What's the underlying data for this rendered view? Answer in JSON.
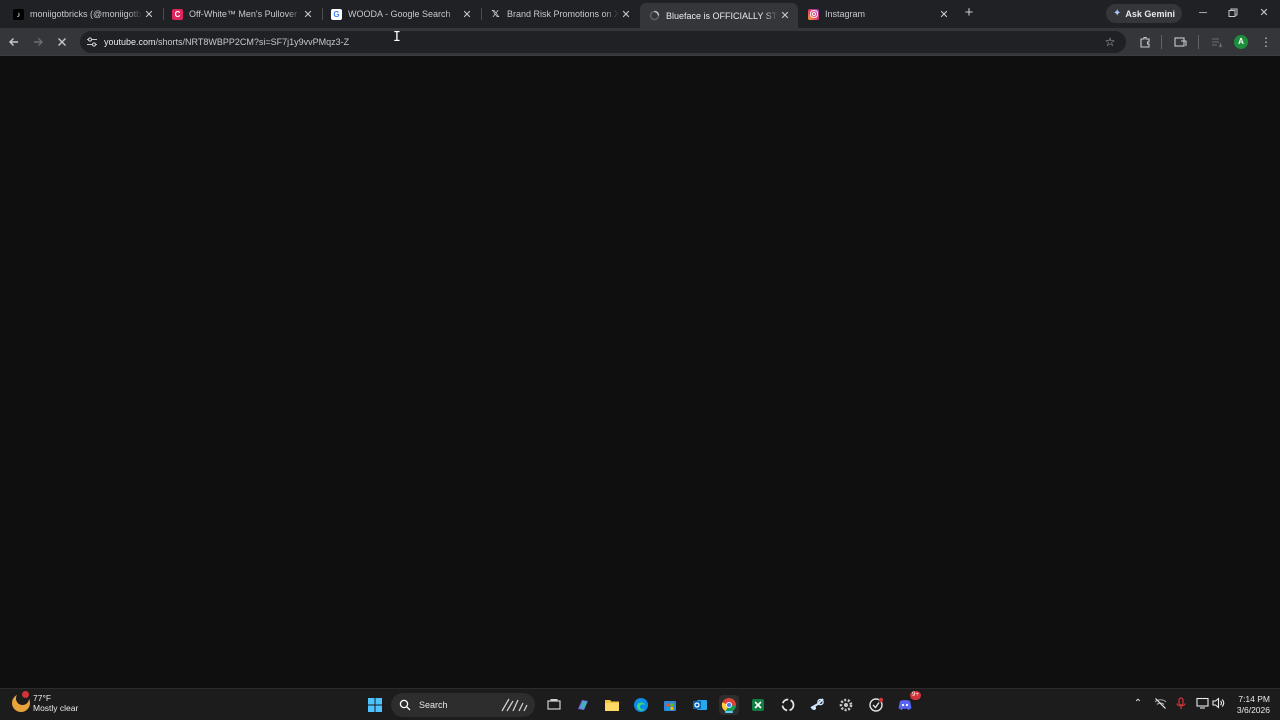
{
  "tabs": [
    {
      "title": "moniigotbricks (@moniigotbricks)",
      "favicon": "tiktok-icon"
    },
    {
      "title": "Off-White™ Men's Pullover Hoodie",
      "favicon": "off-white-icon"
    },
    {
      "title": "WOODA - Google Search",
      "favicon": "google-icon"
    },
    {
      "title": "Brand Risk Promotions on X: \"Blueface",
      "favicon": "x-icon"
    },
    {
      "title": "Blueface is OFFICIALLY STRONG",
      "favicon": "loading-icon"
    },
    {
      "title": "Instagram",
      "favicon": "instagram-icon"
    }
  ],
  "gemini": {
    "label": "Ask Gemini"
  },
  "omnibox": {
    "host": "youtube.com",
    "path": "/shorts/NRT8WBPP2CM?si=SF7j1y9vvPMqz3-Z"
  },
  "profile": {
    "initial": "A",
    "color": "#1e8e3e"
  },
  "taskbar": {
    "weather": {
      "temp": "77°F",
      "condition": "Mostly clear"
    },
    "search_label": "Search",
    "discord_badge": "9+",
    "clock": {
      "time": "7:14 PM",
      "date": "3/6/2026"
    }
  },
  "colors": {
    "page_bg": "#0f0f0f",
    "tabstrip_bg": "#202124",
    "toolbar_bg": "#35363a",
    "accent": "#60cdff"
  }
}
